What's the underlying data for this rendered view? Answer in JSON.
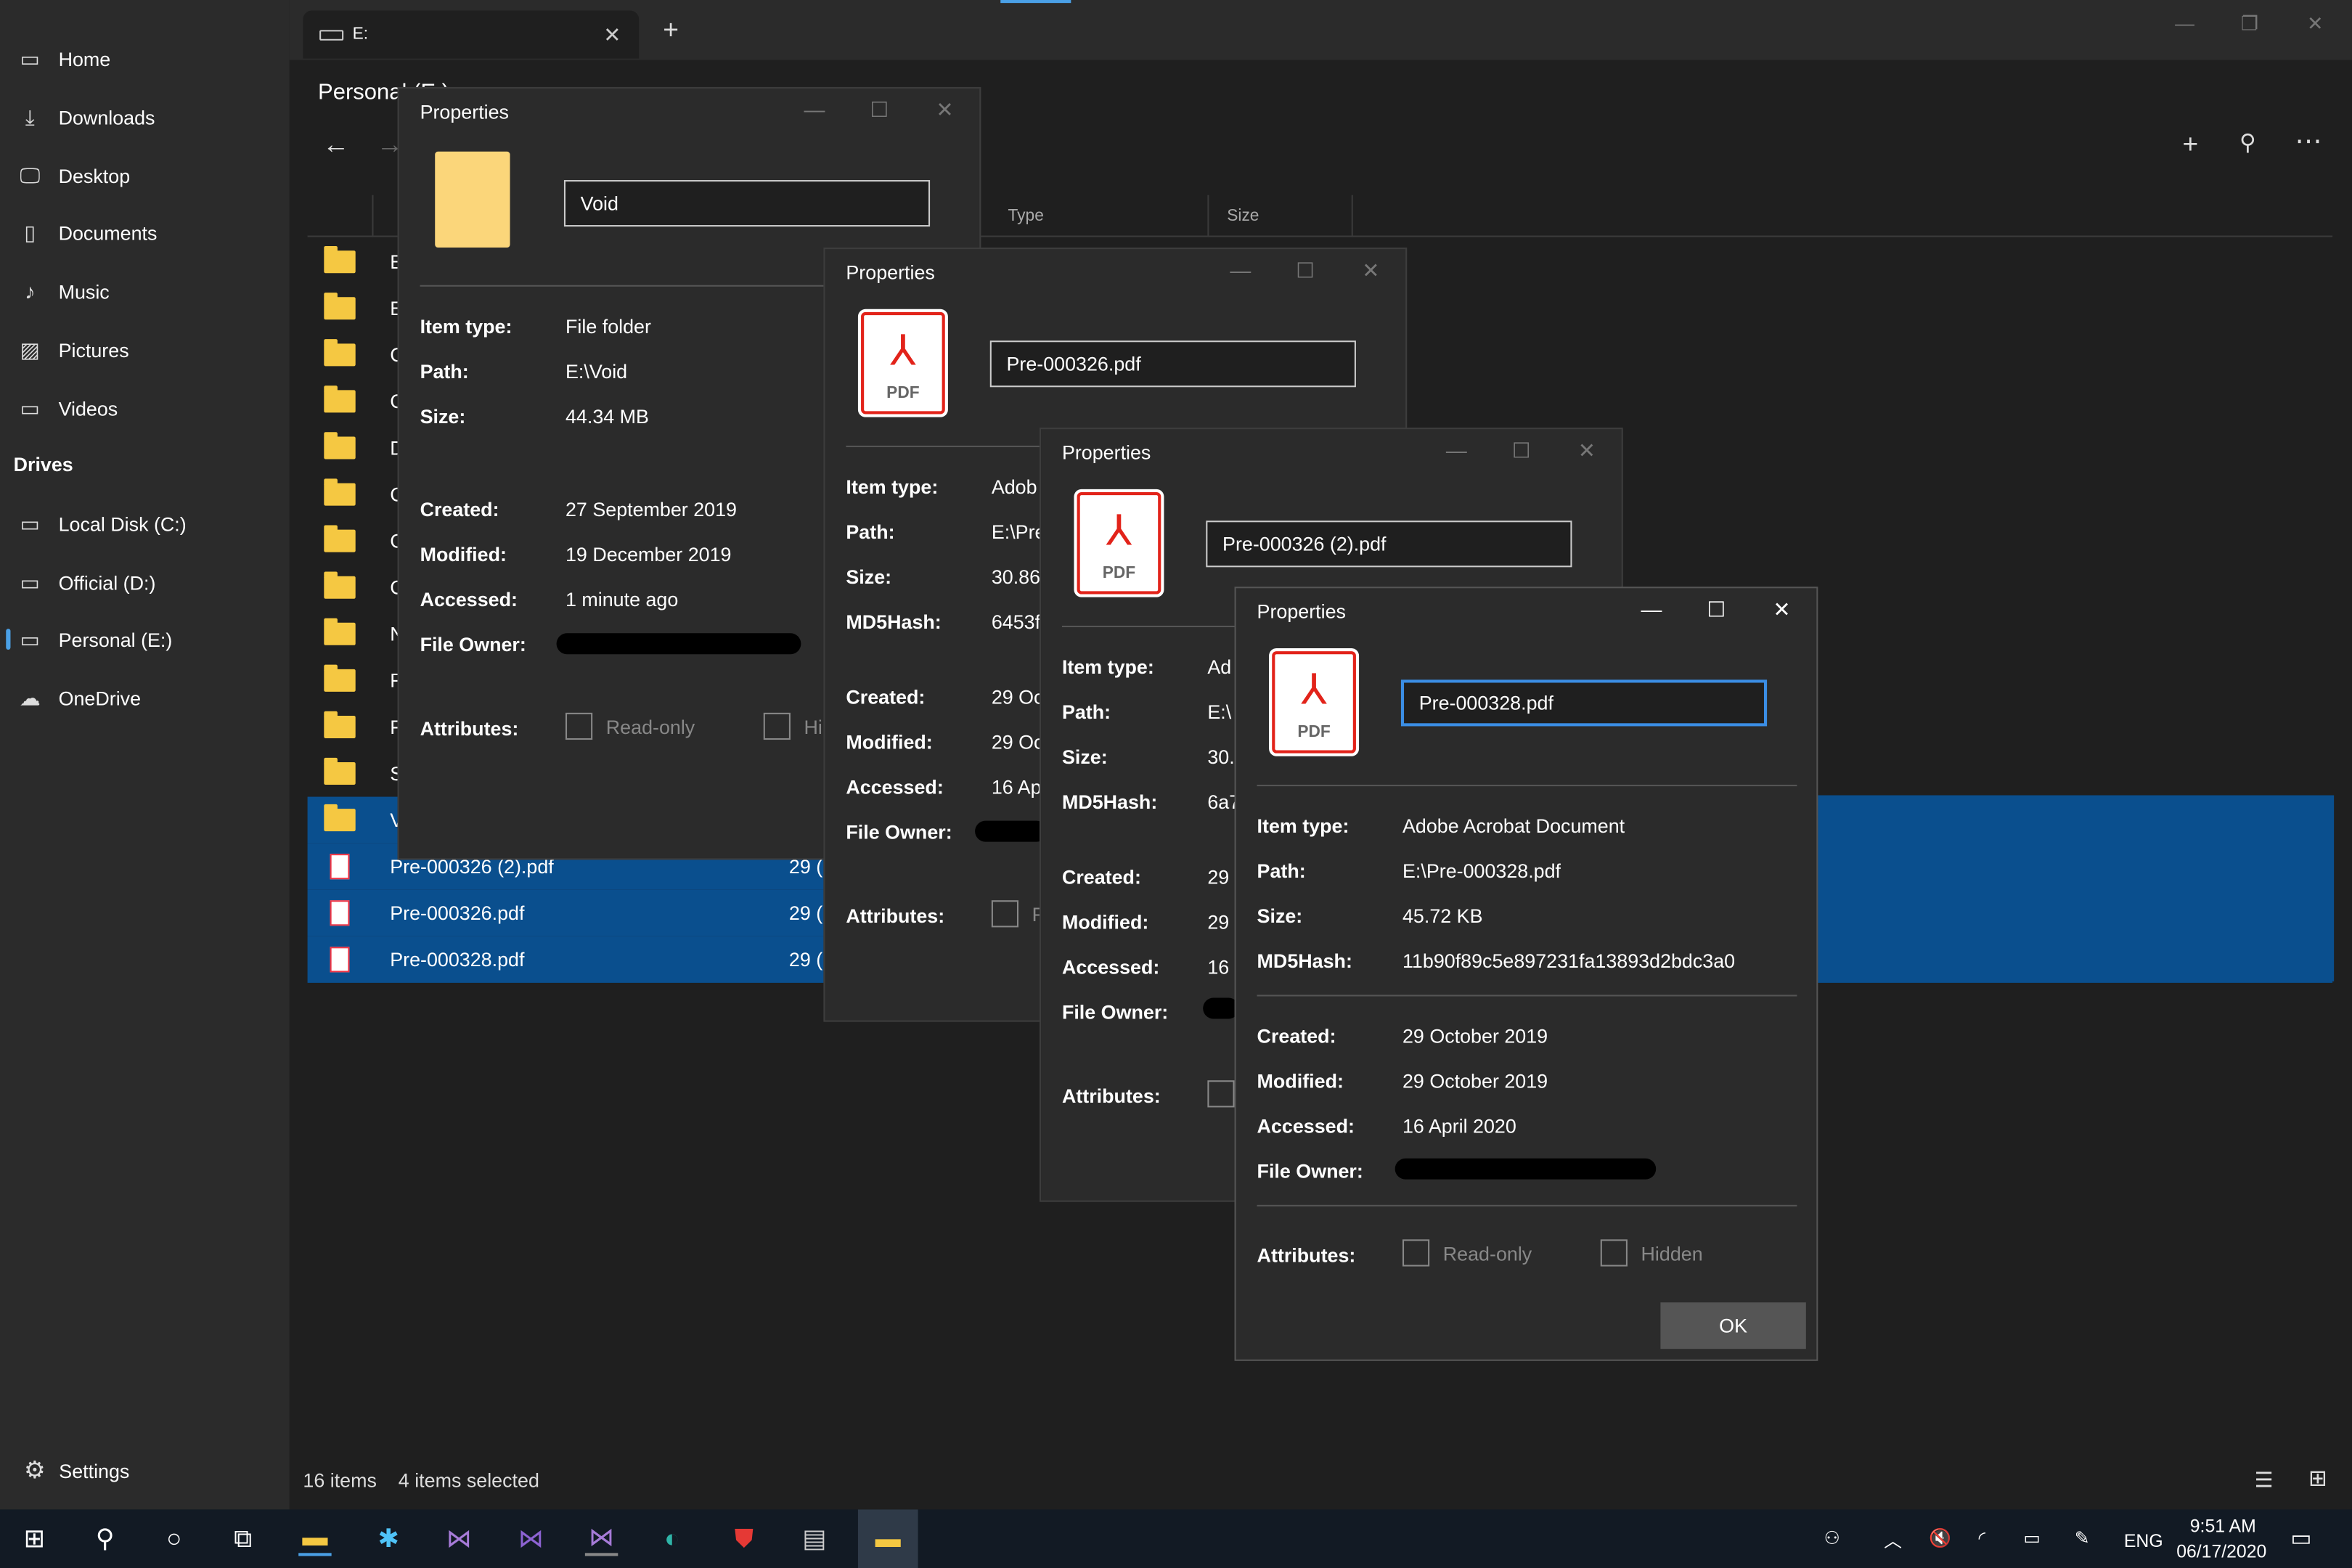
{
  "sidebar": {
    "items": [
      {
        "label": "Home",
        "icon": "home-icon",
        "glyph": "▭"
      },
      {
        "label": "Downloads",
        "icon": "download-icon",
        "glyph": "⤓"
      },
      {
        "label": "Desktop",
        "icon": "desktop-icon",
        "glyph": "🖵"
      },
      {
        "label": "Documents",
        "icon": "document-icon",
        "glyph": "▯"
      },
      {
        "label": "Music",
        "icon": "music-icon",
        "glyph": "♪"
      },
      {
        "label": "Pictures",
        "icon": "pictures-icon",
        "glyph": "▨"
      },
      {
        "label": "Videos",
        "icon": "videos-icon",
        "glyph": "▭"
      }
    ],
    "drives_header": "Drives",
    "drives": [
      {
        "label": "Local Disk (C:)",
        "icon": "drive-icon"
      },
      {
        "label": "Official (D:)",
        "icon": "drive-icon"
      },
      {
        "label": "Personal (E:)",
        "icon": "drive-icon",
        "selected": true
      },
      {
        "label": "OneDrive",
        "icon": "cloud-icon"
      }
    ],
    "settings_label": "Settings"
  },
  "tab": {
    "label": "E:"
  },
  "location_title": "Personal (E:)",
  "columns": {
    "type": "Type",
    "size": "Size"
  },
  "rows": [
    {
      "name": "E",
      "kind": "folder"
    },
    {
      "name": "E",
      "kind": "folder"
    },
    {
      "name": "C",
      "kind": "folder"
    },
    {
      "name": "C",
      "kind": "folder"
    },
    {
      "name": "D",
      "kind": "folder"
    },
    {
      "name": "C",
      "kind": "folder"
    },
    {
      "name": "C",
      "kind": "folder"
    },
    {
      "name": "C",
      "kind": "folder"
    },
    {
      "name": "N",
      "kind": "folder"
    },
    {
      "name": "F",
      "kind": "folder"
    },
    {
      "name": "F",
      "kind": "folder"
    },
    {
      "name": "S",
      "kind": "folder"
    },
    {
      "name": "V",
      "kind": "folder",
      "selected": true
    },
    {
      "name": "Pre-000326 (2).pdf",
      "kind": "pdf",
      "date": "29 (",
      "selected": true
    },
    {
      "name": "Pre-000326.pdf",
      "kind": "pdf",
      "date": "29 (",
      "selected": true
    },
    {
      "name": "Pre-000328.pdf",
      "kind": "pdf",
      "date": "29 (",
      "selected": true
    }
  ],
  "status": {
    "count": "16 items",
    "selected": "4 items selected"
  },
  "dialogs": {
    "title": "Properties",
    "labels": {
      "item_type": "Item type:",
      "path": "Path:",
      "size": "Size:",
      "md5": "MD5Hash:",
      "created": "Created:",
      "modified": "Modified:",
      "accessed": "Accessed:",
      "owner": "File Owner:",
      "attributes": "Attributes:",
      "readonly": "Read-only",
      "hidden": "Hidden"
    },
    "d1": {
      "name": "Void",
      "item_type": "File folder",
      "path": "E:\\Void",
      "size": "44.34 MB",
      "created": "27 September 2019",
      "modified": "19 December 2019",
      "accessed": "1 minute ago",
      "hidden_partial": "Hi"
    },
    "d2": {
      "name": "Pre-000326.pdf",
      "item_type": "Adob",
      "path": "E:\\Pre",
      "size": "30.86",
      "md5": "6453f",
      "created": "29 Oc",
      "modified": "29 Oc",
      "accessed": "16 Ap",
      "readonly_partial": "R"
    },
    "d3": {
      "name": "Pre-000326 (2).pdf",
      "item_type": "Ad",
      "path": "E:\\",
      "size": "30.",
      "md5": "6a7",
      "created": "29",
      "modified": "29",
      "accessed": "16"
    },
    "d4": {
      "name": "Pre-000328.pdf",
      "item_type": "Adobe Acrobat Document",
      "path": "E:\\Pre-000328.pdf",
      "size": "45.72 KB",
      "md5": "11b90f89c5e897231fa13893d2bdc3a0",
      "created": "29 October 2019",
      "modified": "29 October 2019",
      "accessed": "16 April 2020",
      "ok": "OK"
    },
    "pdf_label": "PDF"
  },
  "taskbar": {
    "lang": "ENG",
    "time": "9:51 AM",
    "date": "06/17/2020"
  },
  "colors": {
    "accent": "#0a4f8e",
    "folder": "#f5c842",
    "pdf_red": "#e2231a"
  }
}
